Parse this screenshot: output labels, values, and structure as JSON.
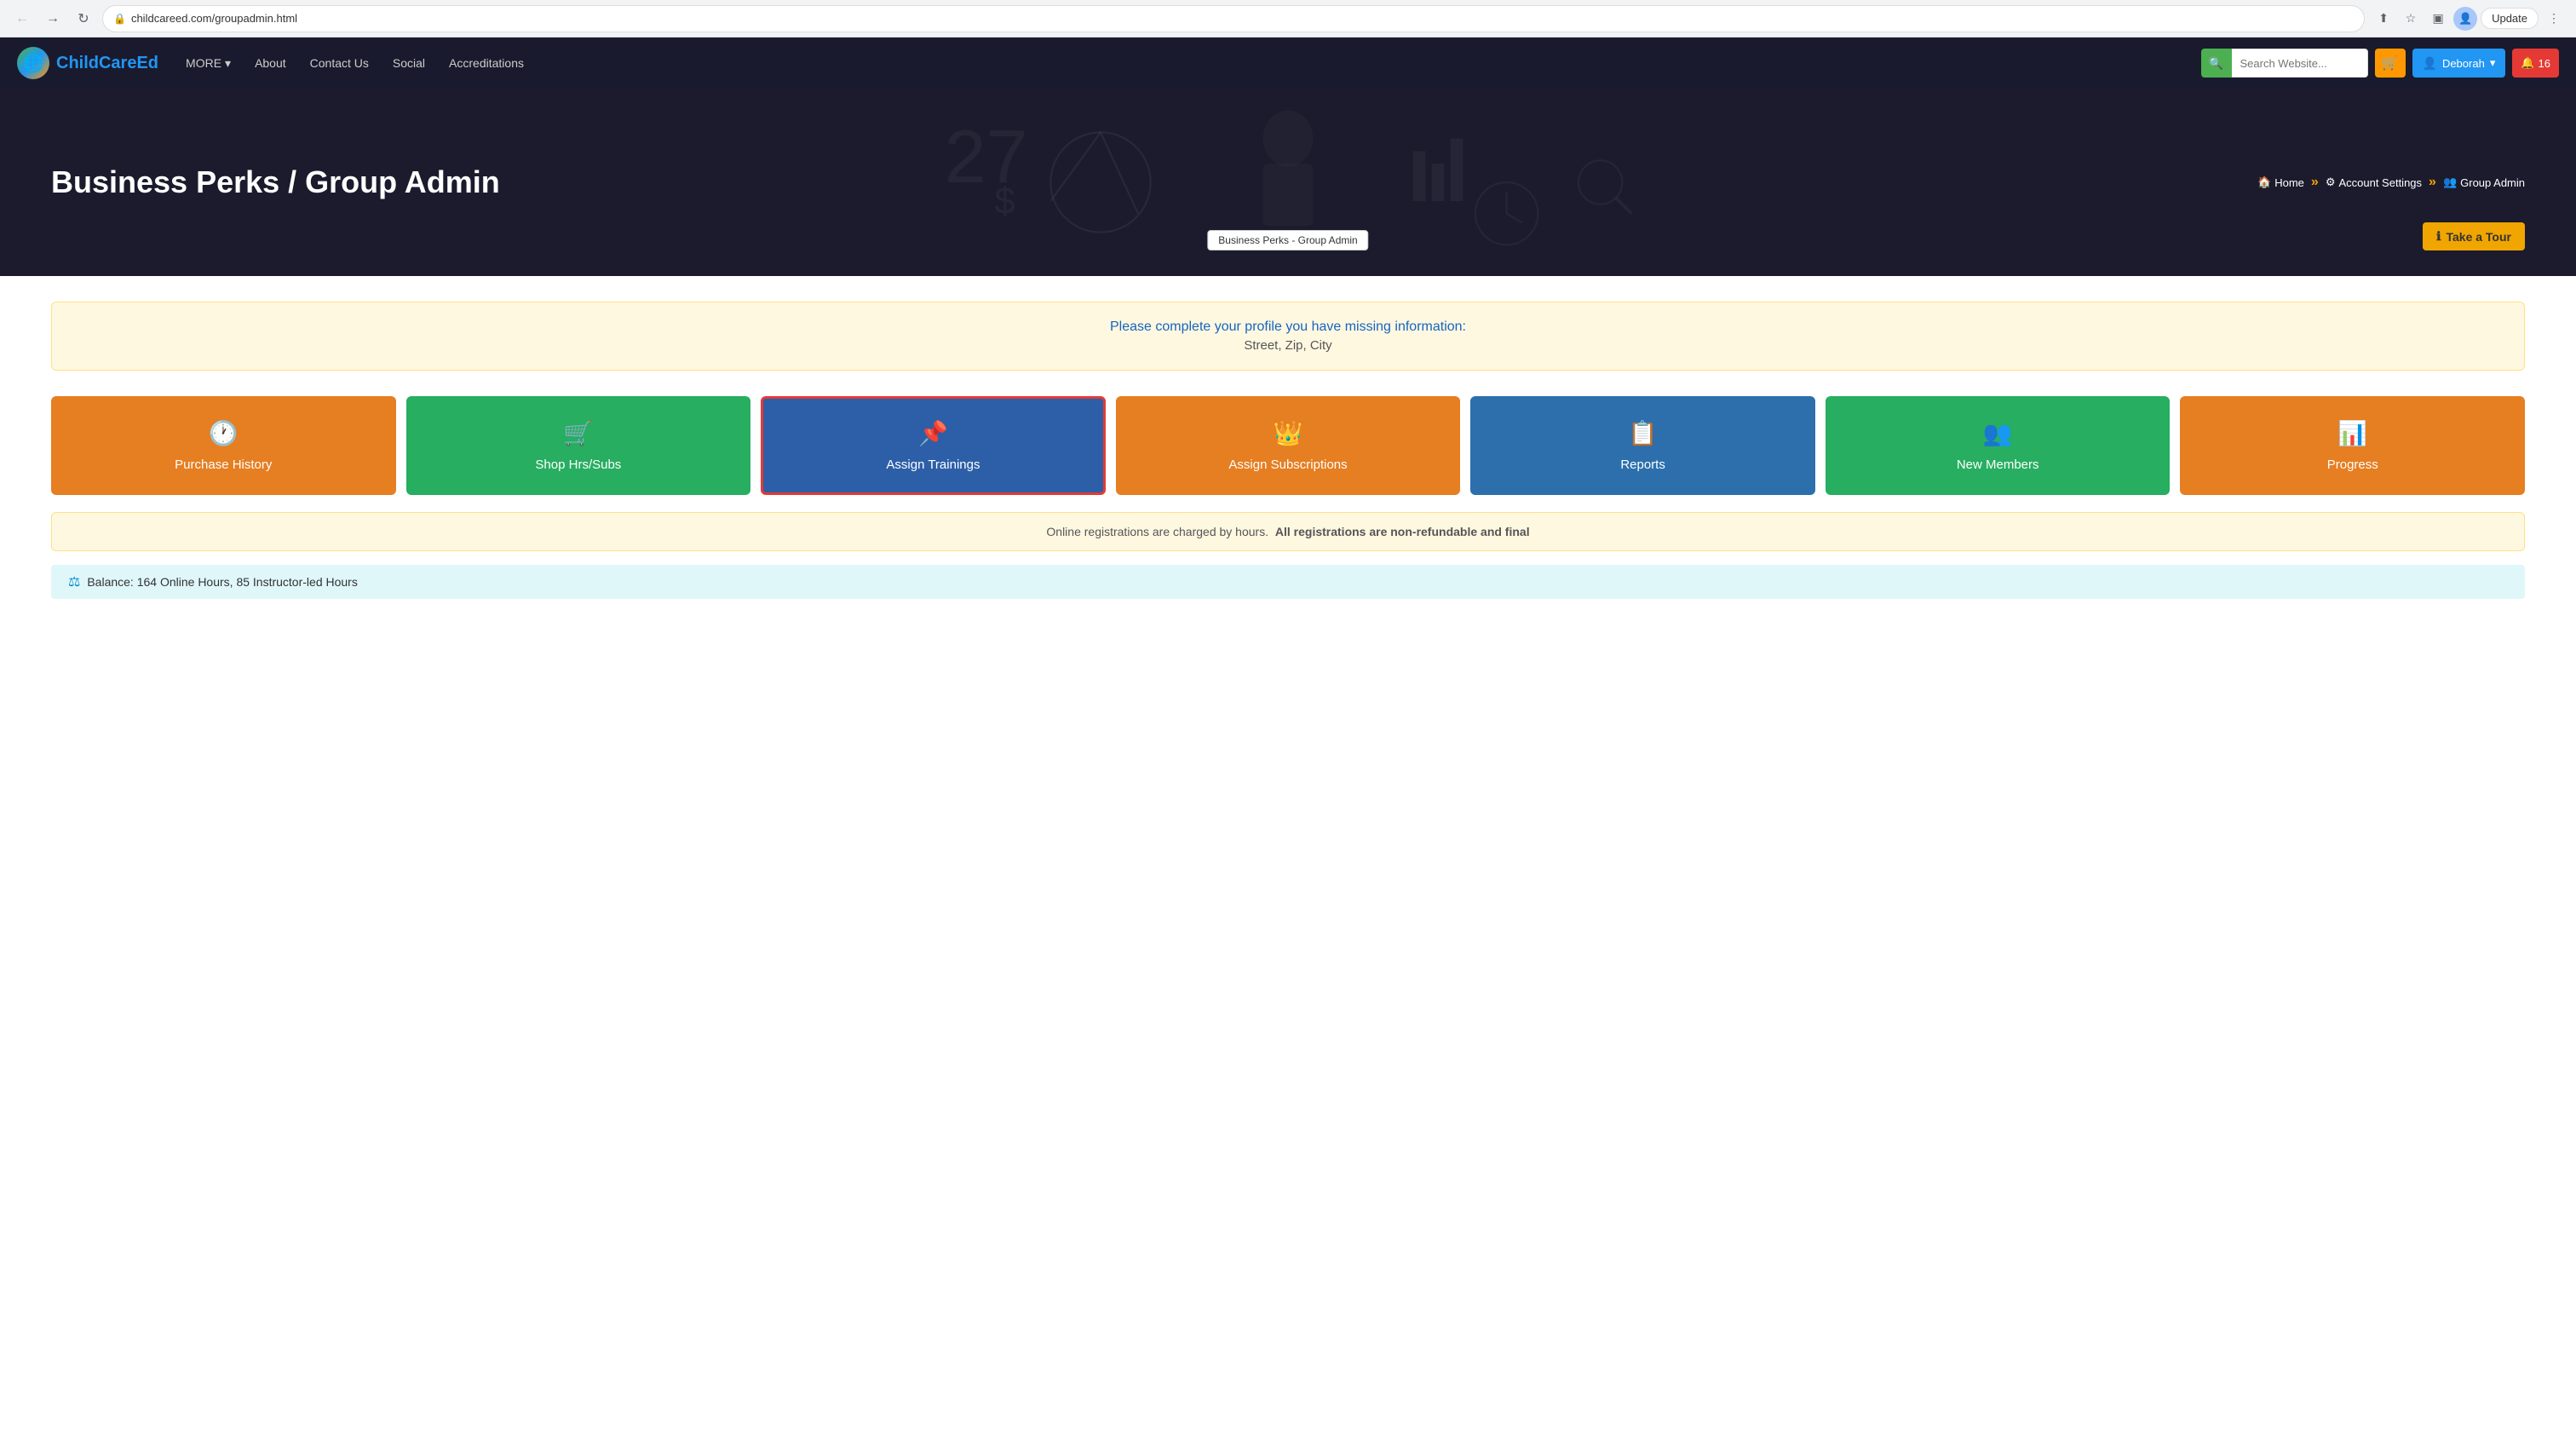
{
  "browser": {
    "url": "childcareed.com/groupadmin.html",
    "update_label": "Update"
  },
  "navbar": {
    "logo_text_first": "ChildCare",
    "logo_text_second": "Ed",
    "more_label": "MORE",
    "nav_items": [
      {
        "label": "About"
      },
      {
        "label": "Contact Us"
      },
      {
        "label": "Social"
      },
      {
        "label": "Accreditations"
      }
    ],
    "search_placeholder": "Search Website...",
    "cart_icon": "🛒",
    "user_label": "Deborah",
    "notification_count": "16"
  },
  "hero": {
    "title": "Business Perks / Group Admin",
    "breadcrumb": {
      "home": "Home",
      "account_settings": "Account Settings",
      "current": "Group Admin"
    },
    "tour_label": "Take a Tour",
    "tooltip": "Business Perks - Group Admin"
  },
  "alert": {
    "link_text": "Please complete your profile you have missing information:",
    "detail": "Street, Zip, City"
  },
  "action_cards": [
    {
      "id": "purchase-history",
      "label": "Purchase History",
      "icon": "🕐",
      "style": "orange"
    },
    {
      "id": "shop-hrs-subs",
      "label": "Shop Hrs/Subs",
      "icon": "🛒",
      "style": "green"
    },
    {
      "id": "assign-trainings",
      "label": "Assign Trainings",
      "icon": "📌",
      "style": "blue-active"
    },
    {
      "id": "assign-subscriptions",
      "label": "Assign Subscriptions",
      "icon": "👑",
      "style": "orange2"
    },
    {
      "id": "reports",
      "label": "Reports",
      "icon": "📋",
      "style": "blue"
    },
    {
      "id": "new-members",
      "label": "New Members",
      "icon": "👥",
      "style": "green2"
    },
    {
      "id": "progress",
      "label": "Progress",
      "icon": "📊",
      "style": "orange3"
    }
  ],
  "info_banner": {
    "text_before": "Online registrations are charged by hours.",
    "bold_text": "All registrations are non-refundable and final"
  },
  "balance": {
    "text": "Balance: 164 Online Hours, 85 Instructor-led Hours"
  }
}
